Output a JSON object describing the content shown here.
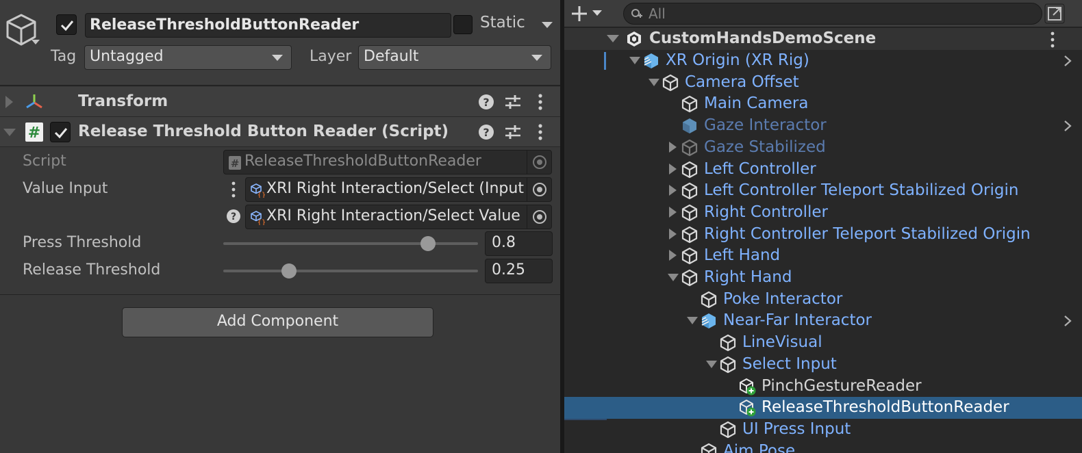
{
  "inspector": {
    "gameobject": {
      "active_checked": true,
      "name": "ReleaseThresholdButtonReader",
      "static_label": "Static",
      "tag_label": "Tag",
      "tag_value": "Untagged",
      "layer_label": "Layer",
      "layer_value": "Default"
    },
    "components": {
      "transform": {
        "title": "Transform"
      },
      "script": {
        "title": "Release Threshold Button Reader (Script)",
        "enabled": true,
        "props": {
          "script_label": "Script",
          "script_value": "ReleaseThresholdButtonReader",
          "value_input_label": "Value Input",
          "value_input_1": "XRI Right Interaction/Select (Input",
          "value_input_2": "XRI Right Interaction/Select Value",
          "press_label": "Press Threshold",
          "press_value": "0.8",
          "press_fraction": 0.8,
          "release_label": "Release Threshold",
          "release_value": "0.25",
          "release_fraction": 0.25
        }
      }
    },
    "add_component_label": "Add Component"
  },
  "hierarchy": {
    "search_placeholder": "All",
    "scene_name": "CustomHandsDemoScene",
    "items": [
      {
        "label": "XR Origin (XR Rig)",
        "depth": 0,
        "fold": "open",
        "icon": "prefab-icon",
        "chevron": true
      },
      {
        "label": "Camera Offset",
        "depth": 1,
        "fold": "open",
        "icon": "cube-icon"
      },
      {
        "label": "Main Camera",
        "depth": 2,
        "fold": "none",
        "icon": "cube-icon"
      },
      {
        "label": "Gaze Interactor",
        "depth": 2,
        "fold": "none",
        "icon": "prefab-icon",
        "dim": true,
        "chevron": true
      },
      {
        "label": "Gaze Stabilized",
        "depth": 2,
        "fold": "closed",
        "icon": "cube-icon",
        "dim": true
      },
      {
        "label": "Left Controller",
        "depth": 2,
        "fold": "closed",
        "icon": "cube-icon"
      },
      {
        "label": "Left Controller Teleport Stabilized Origin",
        "depth": 2,
        "fold": "closed",
        "icon": "cube-icon"
      },
      {
        "label": "Right Controller",
        "depth": 2,
        "fold": "closed",
        "icon": "cube-icon"
      },
      {
        "label": "Right Controller Teleport Stabilized Origin",
        "depth": 2,
        "fold": "closed",
        "icon": "cube-icon"
      },
      {
        "label": "Left Hand",
        "depth": 2,
        "fold": "closed",
        "icon": "cube-icon"
      },
      {
        "label": "Right Hand",
        "depth": 2,
        "fold": "open",
        "icon": "cube-icon"
      },
      {
        "label": "Poke Interactor",
        "depth": 3,
        "fold": "none",
        "icon": "cube-icon"
      },
      {
        "label": "Near-Far Interactor",
        "depth": 3,
        "fold": "open",
        "icon": "prefab-icon",
        "chevron": true
      },
      {
        "label": "LineVisual",
        "depth": 4,
        "fold": "none",
        "icon": "cube-icon"
      },
      {
        "label": "Select Input",
        "depth": 4,
        "fold": "open",
        "icon": "cube-icon"
      },
      {
        "label": "PinchGestureReader",
        "depth": 5,
        "fold": "none",
        "icon": "added-object-icon",
        "white": true
      },
      {
        "label": "ReleaseThresholdButtonReader",
        "depth": 5,
        "fold": "none",
        "icon": "added-object-icon",
        "selected": true
      },
      {
        "label": "UI Press Input",
        "depth": 4,
        "fold": "none",
        "icon": "cube-icon"
      },
      {
        "label": "Aim Pose",
        "depth": 3,
        "fold": "none",
        "icon": "cube-icon"
      }
    ]
  }
}
